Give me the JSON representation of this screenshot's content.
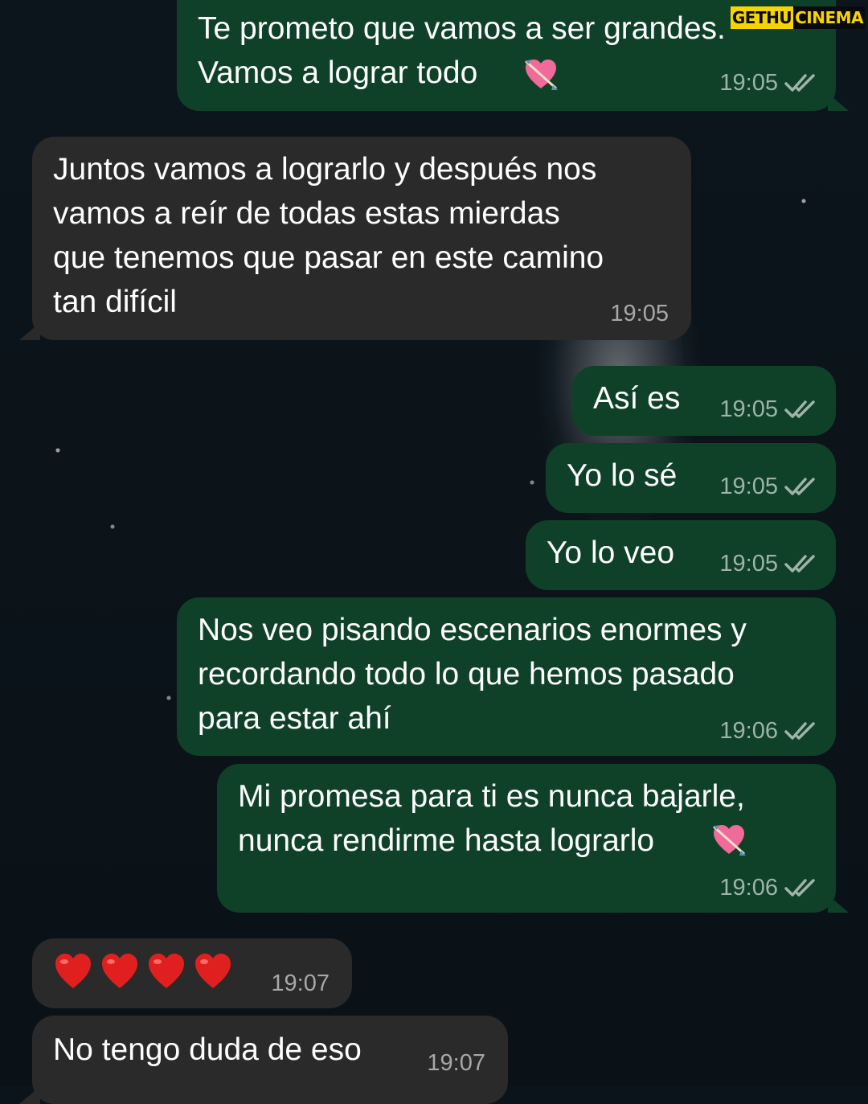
{
  "watermark": {
    "part1": "GETHU",
    "part2": "CINEMA"
  },
  "colors": {
    "outgoing_bubble": "#0f4128",
    "incoming_bubble": "#2a2a2a",
    "background": "#0c141b",
    "read_ticks": "#9fb3a7"
  },
  "messages": [
    {
      "direction": "outgoing",
      "text": "Te prometo que vamos a ser grandes.\nVamos a lograr todo",
      "emoji": "heart-with-arrow",
      "time": "19:05",
      "status": "read"
    },
    {
      "direction": "incoming",
      "text": "Juntos vamos a lograrlo y después nos\nvamos a reír de todas estas mierdas\nque tenemos que pasar en este camino\ntan difícil",
      "time": "19:05"
    },
    {
      "direction": "outgoing",
      "text": "Así es",
      "time": "19:05",
      "status": "read"
    },
    {
      "direction": "outgoing",
      "text": "Yo lo sé",
      "time": "19:05",
      "status": "read"
    },
    {
      "direction": "outgoing",
      "text": "Yo lo veo",
      "time": "19:05",
      "status": "read"
    },
    {
      "direction": "outgoing",
      "text": "Nos veo pisando escenarios enormes y\nrecordando todo lo que hemos pasado\npara estar ahí",
      "time": "19:06",
      "status": "read"
    },
    {
      "direction": "outgoing",
      "text": "Mi promesa para ti es nunca bajarle,\nnunca rendirme hasta lograrlo",
      "emoji": "heart-with-arrow",
      "time": "19:06",
      "status": "read"
    },
    {
      "direction": "incoming",
      "text": "",
      "emoji": "red-heart x4",
      "time": "19:07"
    },
    {
      "direction": "incoming",
      "text": "No tengo duda de eso",
      "time": "19:07"
    }
  ]
}
